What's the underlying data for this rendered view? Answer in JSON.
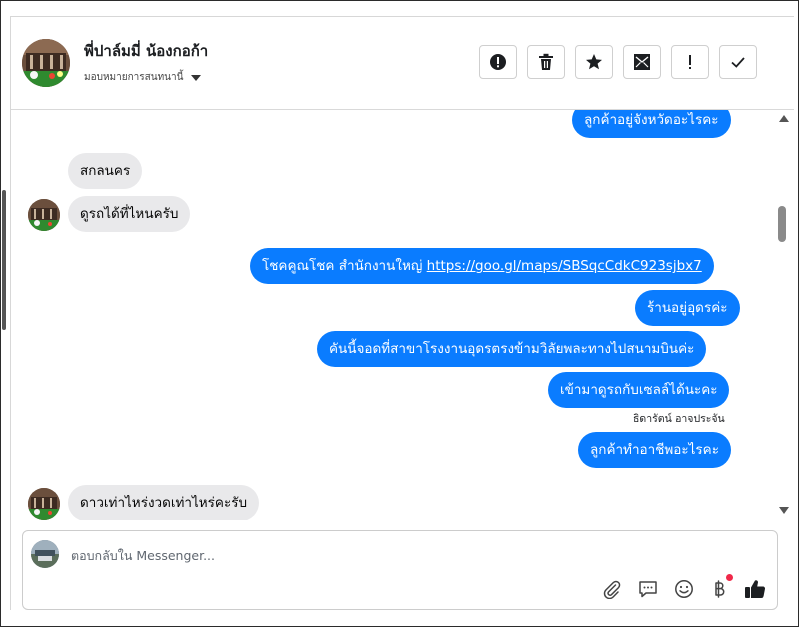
{
  "header": {
    "contact_name": "พี่ปาล์มมี่ น้องกอก้า",
    "assign_label": "มอบหมายการสนทนานี้",
    "toolbar": [
      {
        "name": "spam-button",
        "icon": "alert-circle-icon"
      },
      {
        "name": "delete-button",
        "icon": "trash-icon"
      },
      {
        "name": "star-button",
        "icon": "star-icon"
      },
      {
        "name": "mark-unread-button",
        "icon": "envelope-icon"
      },
      {
        "name": "follow-up-button",
        "icon": "exclamation-icon"
      },
      {
        "name": "mark-done-button",
        "icon": "check-icon"
      }
    ]
  },
  "messages": [
    {
      "dir": "out",
      "text": "ลูกค้าอยู่จังหวัดอะไรคะ"
    },
    {
      "dir": "in",
      "text": "สกลนคร"
    },
    {
      "dir": "in",
      "text": "ดูรถได้ที่ไหนครับ"
    },
    {
      "dir": "out",
      "text": "โชคคูณโชค สำนักงานใหญ่ ",
      "link": "https://goo.gl/maps/SBSqcCdkC923sjbx7"
    },
    {
      "dir": "out",
      "text": "ร้านอยู่อุดรค่ะ"
    },
    {
      "dir": "out",
      "text": "คันนี้จอดที่สาขาโรงงานอุดรตรงข้ามวิลัยพละทางไปสนามบินค่ะ"
    },
    {
      "dir": "out",
      "text": "เข้ามาดูรถกับเซลล์ได้นะคะ"
    },
    {
      "dir": "out",
      "text": "ลูกค้าทำอาชีพอะไรคะ"
    },
    {
      "dir": "in",
      "text": "ดาวเท่าไหร่งวดเท่าไหร่คะรับ"
    }
  ],
  "sender_label": "ธิดารัตน์ อาจประจัน",
  "composer": {
    "placeholder": "ตอบกลับใน Messenger...",
    "icons": [
      "paperclip-icon",
      "chat-bubble-icon",
      "smiley-icon",
      "baht-icon",
      "thumbs-up-icon"
    ]
  },
  "colors": {
    "outgoing_bubble": "#0a7cff",
    "incoming_bubble": "#e9e9eb",
    "notification_dot": "#f02849"
  }
}
